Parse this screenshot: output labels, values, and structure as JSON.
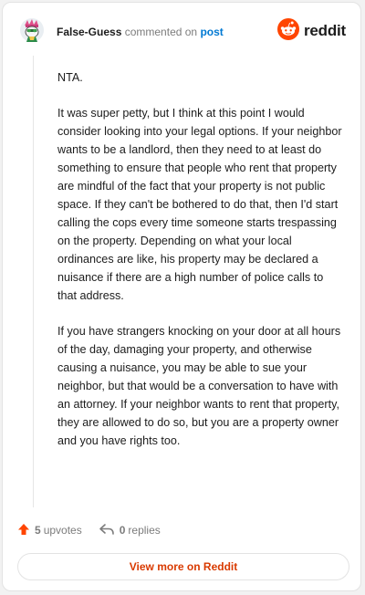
{
  "header": {
    "username": "False-Guess",
    "action": "commented on",
    "post_link": "post",
    "logo_text": "reddit",
    "avatar_icon": "snoo-avatar-icon",
    "logo_icon": "reddit-snoo-icon"
  },
  "comment": {
    "paragraphs": [
      "NTA.",
      "It was super petty, but I think at this point I would consider looking into your legal options. If your neighbor wants to be a landlord, then they need to at least do something to ensure that people who rent that property are mindful of the fact that your property is not public space. If they can't be bothered to do that, then I'd start calling the cops every time someone starts trespassing on the property. Depending on what your local ordinances are like, his property may be declared a nuisance if there are a high number of police calls to that address.",
      "If you have strangers knocking on your door at all hours of the day, damaging your property, and otherwise causing a nuisance, you may be able to sue your neighbor, but that would be a conversation to have with an attorney. If your neighbor wants to rent that property, they are allowed to do so, but you are a property owner and you have rights too."
    ]
  },
  "footer": {
    "upvotes_count": "5",
    "upvotes_label": "upvotes",
    "replies_count": "0",
    "replies_label": "replies",
    "upvote_icon": "upvote-arrow-icon",
    "reply_icon": "reply-arrow-icon"
  },
  "view_button": {
    "label": "View more on Reddit"
  },
  "colors": {
    "accent": "#d93a00",
    "upvote": "#ff4500",
    "link": "#0079d3",
    "muted": "#7c7c7c"
  }
}
